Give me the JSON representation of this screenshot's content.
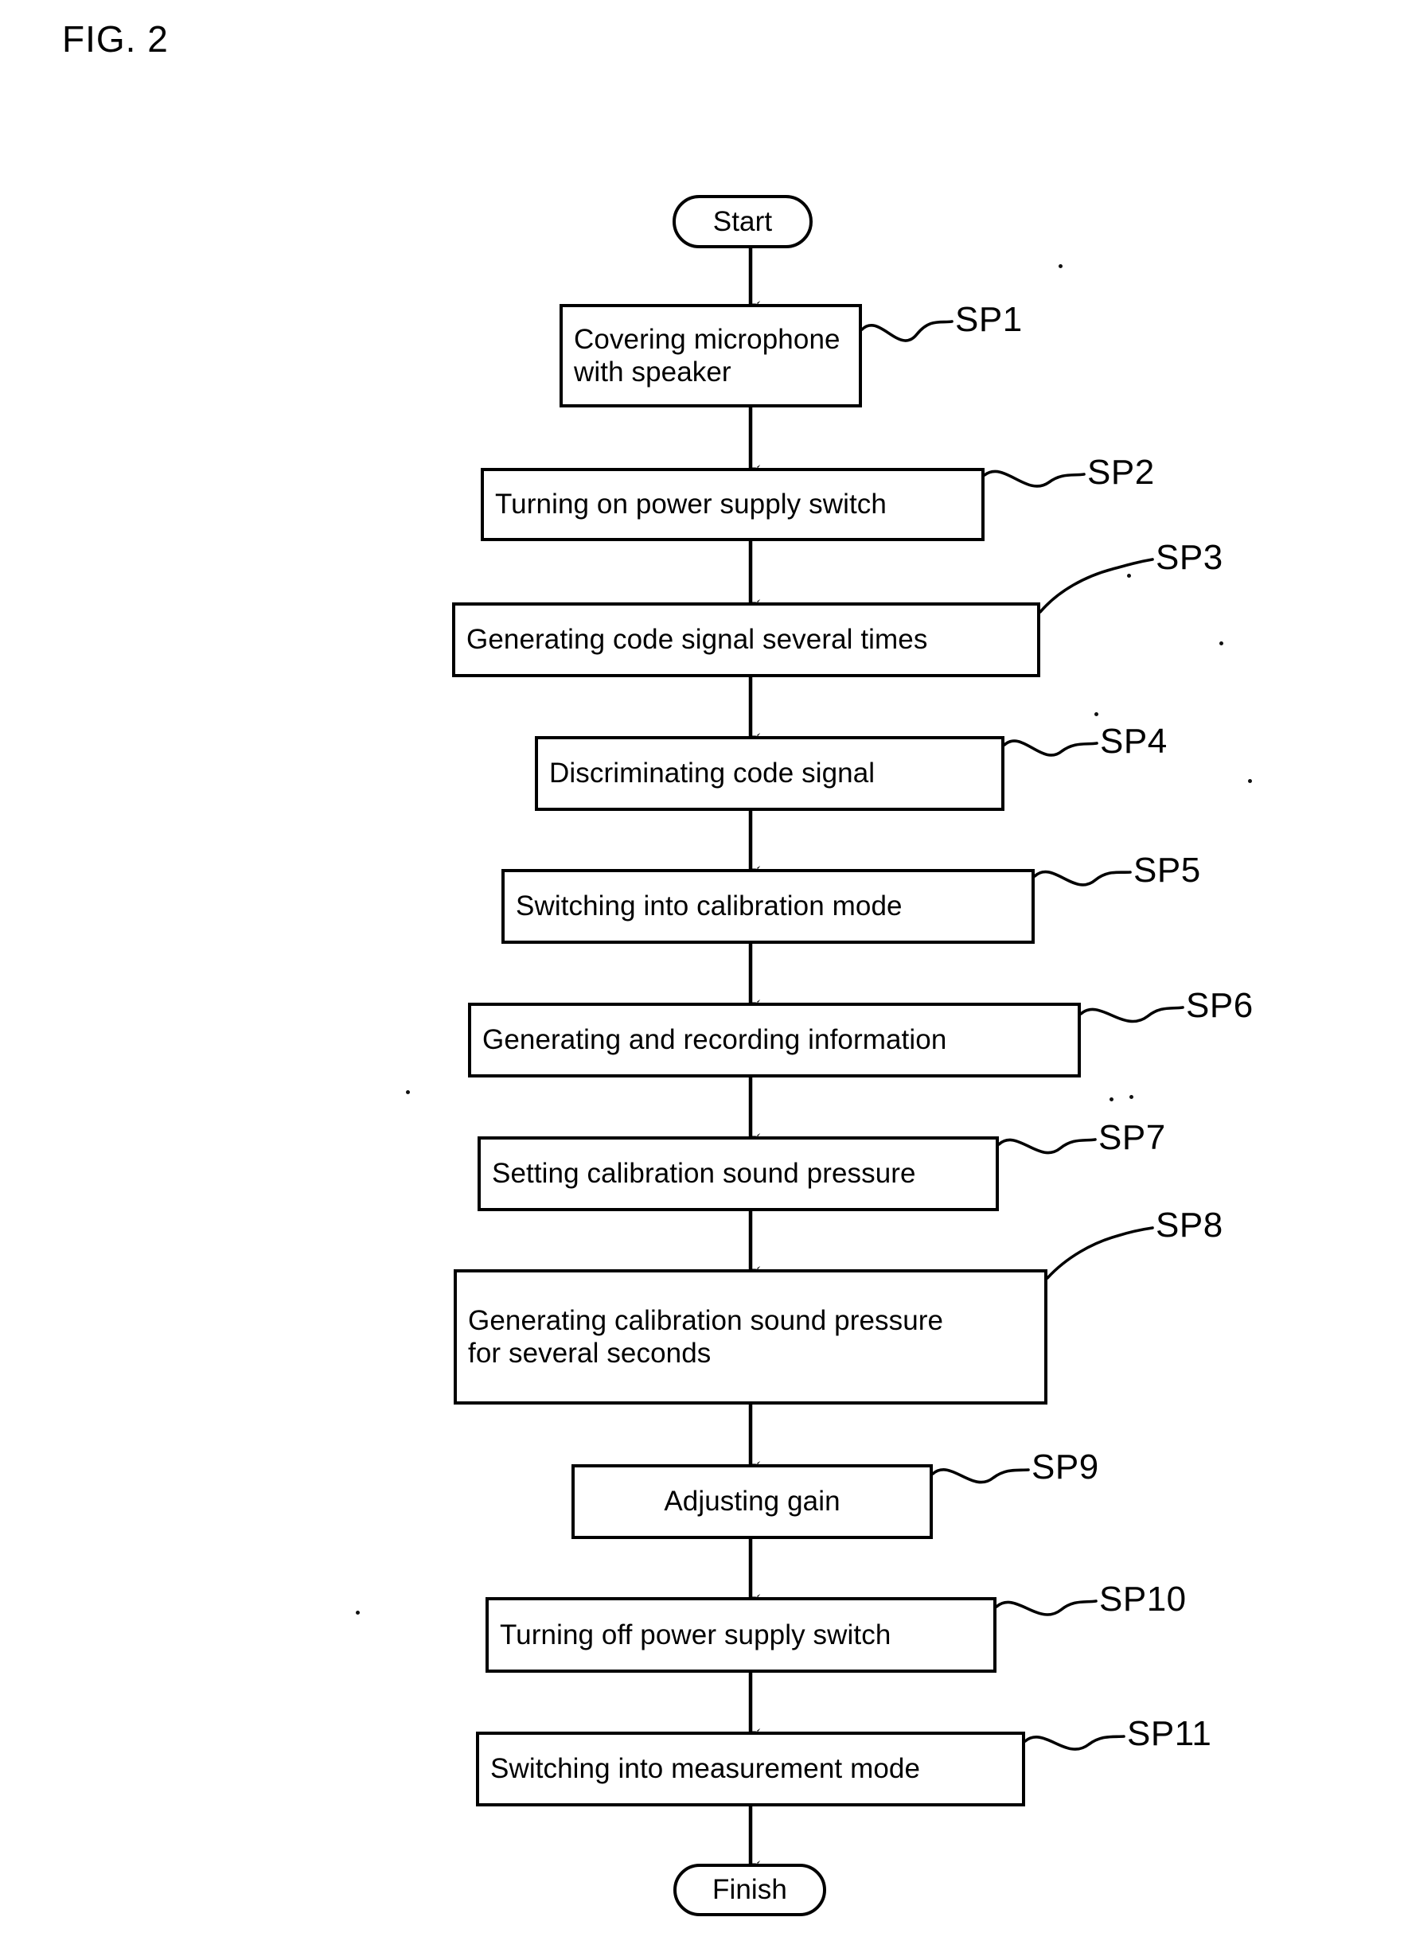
{
  "figure": {
    "label": "FIG. 2",
    "type": "flowchart",
    "orientation": "vertical-top-to-bottom"
  },
  "nodes": [
    {
      "id": "start",
      "shape": "terminator",
      "text": "Start"
    },
    {
      "id": "sp1",
      "shape": "process",
      "text": "Covering microphone\nwith speaker",
      "ref": "SP1"
    },
    {
      "id": "sp2",
      "shape": "process",
      "text": "Turning on power supply switch",
      "ref": "SP2"
    },
    {
      "id": "sp3",
      "shape": "process",
      "text": "Generating code signal several times",
      "ref": "SP3"
    },
    {
      "id": "sp4",
      "shape": "process",
      "text": "Discriminating code signal",
      "ref": "SP4"
    },
    {
      "id": "sp5",
      "shape": "process",
      "text": "Switching into calibration mode",
      "ref": "SP5"
    },
    {
      "id": "sp6",
      "shape": "process",
      "text": "Generating and recording information",
      "ref": "SP6"
    },
    {
      "id": "sp7",
      "shape": "process",
      "text": "Setting calibration sound pressure",
      "ref": "SP7"
    },
    {
      "id": "sp8",
      "shape": "process",
      "text": "Generating calibration sound pressure\nfor several seconds",
      "ref": "SP8"
    },
    {
      "id": "sp9",
      "shape": "process",
      "text": "Adjusting gain",
      "ref": "SP9"
    },
    {
      "id": "sp10",
      "shape": "process",
      "text": "Turning off power supply switch",
      "ref": "SP10"
    },
    {
      "id": "sp11",
      "shape": "process",
      "text": "Switching into measurement mode",
      "ref": "SP11"
    },
    {
      "id": "finish",
      "shape": "terminator",
      "text": "Finish"
    }
  ],
  "step_labels": {
    "sp1": "SP1",
    "sp2": "SP2",
    "sp3": "SP3",
    "sp4": "SP4",
    "sp5": "SP5",
    "sp6": "SP6",
    "sp7": "SP7",
    "sp8": "SP8",
    "sp9": "SP9",
    "sp10": "SP10",
    "sp11": "SP11"
  },
  "node_text": {
    "start": "Start",
    "sp1": "Covering microphone\nwith speaker",
    "sp2": "Turning on power supply switch",
    "sp3": "Generating code signal several times",
    "sp4": "Discriminating code signal",
    "sp5": "Switching into calibration mode",
    "sp6": "Generating and recording information",
    "sp7": "Setting calibration sound pressure",
    "sp8": "Generating calibration sound pressure\nfor several seconds",
    "sp9": "Adjusting gain",
    "sp10": "Turning off power supply switch",
    "sp11": "Switching into measurement mode",
    "finish": "Finish"
  },
  "edges": [
    {
      "from": "start",
      "to": "sp1"
    },
    {
      "from": "sp1",
      "to": "sp2"
    },
    {
      "from": "sp2",
      "to": "sp3"
    },
    {
      "from": "sp3",
      "to": "sp4"
    },
    {
      "from": "sp4",
      "to": "sp5"
    },
    {
      "from": "sp5",
      "to": "sp6"
    },
    {
      "from": "sp6",
      "to": "sp7"
    },
    {
      "from": "sp7",
      "to": "sp8"
    },
    {
      "from": "sp8",
      "to": "sp9"
    },
    {
      "from": "sp9",
      "to": "sp10"
    },
    {
      "from": "sp10",
      "to": "sp11"
    },
    {
      "from": "sp11",
      "to": "finish"
    }
  ],
  "colors": {
    "stroke": "#000000",
    "fill": "#ffffff",
    "text": "#000000"
  }
}
